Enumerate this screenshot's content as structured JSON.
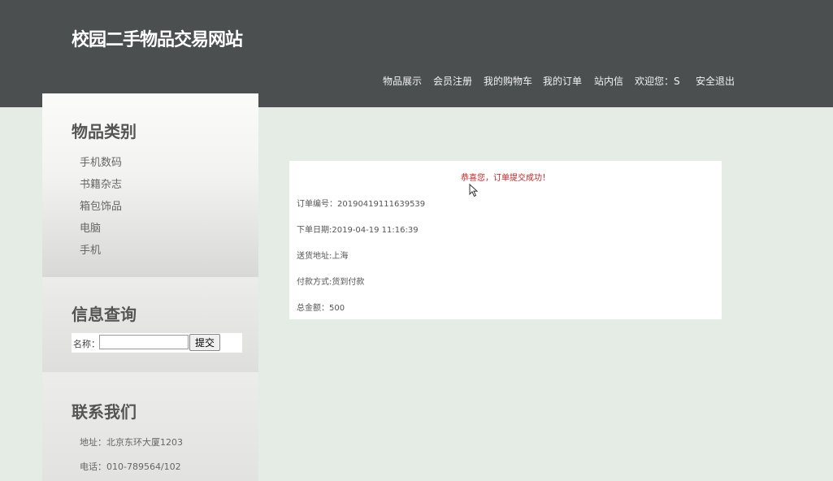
{
  "site": {
    "title": "校园二手物品交易网站"
  },
  "nav": {
    "items": [
      "物品展示",
      "会员注册",
      "我的购物车",
      "我的订单",
      "站内信",
      "欢迎您：S",
      "安全退出"
    ]
  },
  "sidebar": {
    "categories_title": "物品类别",
    "categories": [
      "手机数码",
      "书籍杂志",
      "箱包饰品",
      "电脑",
      "手机"
    ],
    "search_title": "信息查询",
    "search_label": "名称：",
    "search_value": "",
    "search_button": "提交",
    "contact_title": "联系我们",
    "address": "地址：北京东环大厦1203",
    "phone": "电话：010-789564/102"
  },
  "order": {
    "success_message": "恭喜您，订单提交成功！",
    "number": "订单编号：20190419111639539",
    "date": "下单日期:2019-04-19 11:16:39",
    "address": "送货地址:上海",
    "payment": "付款方式:货到付款",
    "total": "总金额：500"
  },
  "colors": {
    "header_bg": "#4b4f50",
    "page_bg": "#e5ebe5",
    "success_text": "#cc1f1f"
  }
}
